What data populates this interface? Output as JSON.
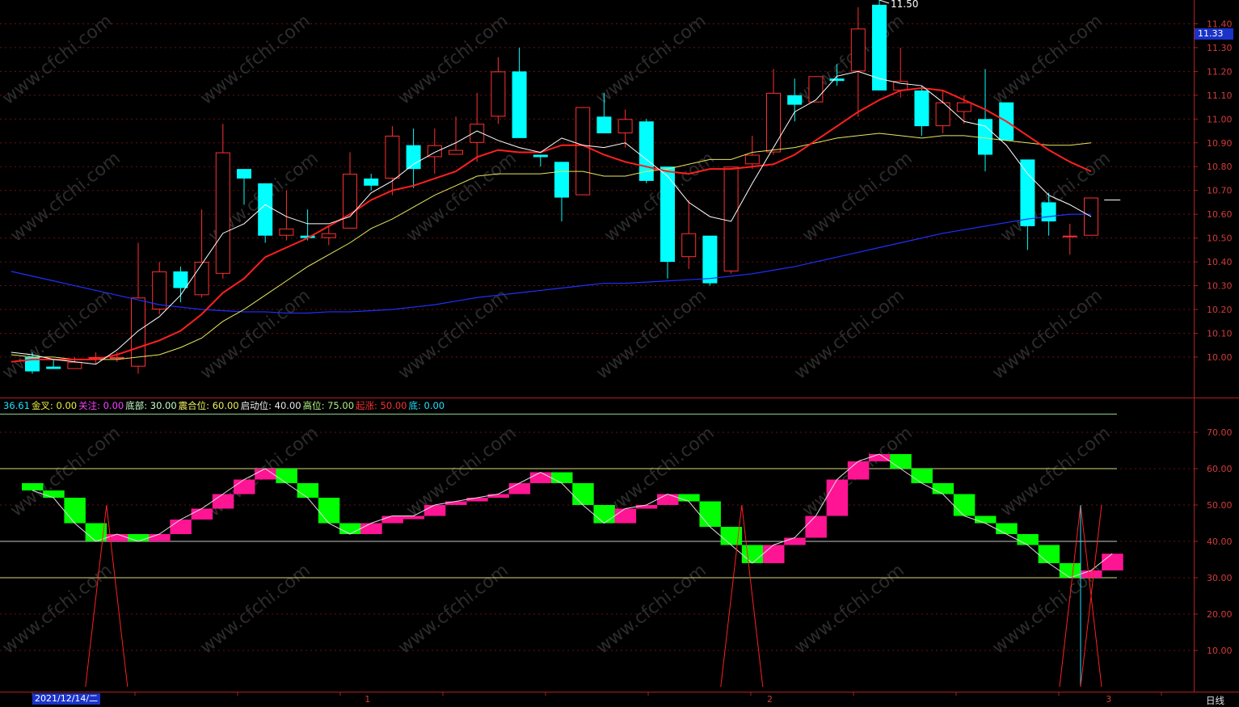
{
  "price_tag": "11.33",
  "period_label": "日线",
  "date_label": "2021/12/14/二",
  "xaxis_marks": [
    {
      "label": "1",
      "idx": 16
    },
    {
      "label": "2",
      "idx": 35
    },
    {
      "label": "3",
      "idx": 51
    }
  ],
  "indicator_header": [
    {
      "text": "36.61",
      "color": "#20e0ff"
    },
    {
      "text": "金叉: 0.00",
      "color": "#f0f040"
    },
    {
      "text": "关注: 0.00",
      "color": "#ff40ff"
    },
    {
      "text": "底部: 30.00",
      "color": "#c8ffc8"
    },
    {
      "text": "震合位: 60.00",
      "color": "#f0f060"
    },
    {
      "text": "启动位: 40.00",
      "color": "#e8e8e8"
    },
    {
      "text": "高位: 75.00",
      "color": "#b0f080"
    },
    {
      "text": "起涨: 50.00",
      "color": "#ff3030"
    },
    {
      "text": "底: 0.00",
      "color": "#20e0ff"
    }
  ],
  "watermark": "www.cfchi.com",
  "chart_data": [
    {
      "type": "candlestick",
      "title": "",
      "ylim": [
        9.83,
        11.5
      ],
      "yticks": [
        "10.00",
        "10.10",
        "10.20",
        "10.30",
        "10.40",
        "10.50",
        "10.60",
        "10.70",
        "10.80",
        "10.90",
        "11.00",
        "11.10",
        "11.20",
        "11.30",
        "11.40"
      ],
      "high_annotation": "11.50",
      "colors": {
        "up": "#ff3030",
        "down": "#00ffff",
        "ma5": "#ffffff",
        "ma10": "#ff2020",
        "ma20": "#e8e860",
        "ma60": "#2030ff"
      },
      "candles": [
        {
          "o": 10.0,
          "h": 10.02,
          "l": 9.93,
          "c": 9.94
        },
        {
          "o": 9.96,
          "h": 9.99,
          "l": 9.95,
          "c": 9.95
        },
        {
          "o": 9.95,
          "h": 10.0,
          "l": 9.95,
          "c": 9.98
        },
        {
          "o": 10.0,
          "h": 10.02,
          "l": 9.97,
          "c": 10.0
        },
        {
          "o": 10.0,
          "h": 10.02,
          "l": 9.98,
          "c": 10.0
        },
        {
          "o": 9.96,
          "h": 10.48,
          "l": 9.93,
          "c": 10.25
        },
        {
          "o": 10.2,
          "h": 10.4,
          "l": 10.18,
          "c": 10.36
        },
        {
          "o": 10.36,
          "h": 10.38,
          "l": 10.23,
          "c": 10.29
        },
        {
          "o": 10.26,
          "h": 10.62,
          "l": 10.25,
          "c": 10.4
        },
        {
          "o": 10.35,
          "h": 10.98,
          "l": 10.33,
          "c": 10.86
        },
        {
          "o": 10.79,
          "h": 10.79,
          "l": 10.64,
          "c": 10.75
        },
        {
          "o": 10.73,
          "h": 10.73,
          "l": 10.48,
          "c": 10.51
        },
        {
          "o": 10.51,
          "h": 10.7,
          "l": 10.49,
          "c": 10.54
        },
        {
          "o": 10.51,
          "h": 10.62,
          "l": 10.49,
          "c": 10.5
        },
        {
          "o": 10.5,
          "h": 10.55,
          "l": 10.47,
          "c": 10.52
        },
        {
          "o": 10.54,
          "h": 10.86,
          "l": 10.54,
          "c": 10.77
        },
        {
          "o": 10.75,
          "h": 10.77,
          "l": 10.7,
          "c": 10.72
        },
        {
          "o": 10.75,
          "h": 10.97,
          "l": 10.68,
          "c": 10.93
        },
        {
          "o": 10.89,
          "h": 10.96,
          "l": 10.71,
          "c": 10.79
        },
        {
          "o": 10.84,
          "h": 10.96,
          "l": 10.77,
          "c": 10.89
        },
        {
          "o": 10.85,
          "h": 11.01,
          "l": 10.85,
          "c": 10.87
        },
        {
          "o": 10.9,
          "h": 11.11,
          "l": 10.82,
          "c": 10.98
        },
        {
          "o": 11.01,
          "h": 11.26,
          "l": 10.98,
          "c": 11.2
        },
        {
          "o": 11.2,
          "h": 11.3,
          "l": 10.94,
          "c": 10.92
        },
        {
          "o": 10.85,
          "h": 10.85,
          "l": 10.8,
          "c": 10.84
        },
        {
          "o": 10.82,
          "h": 10.82,
          "l": 10.57,
          "c": 10.67
        },
        {
          "o": 10.68,
          "h": 11.05,
          "l": 10.68,
          "c": 11.05
        },
        {
          "o": 11.01,
          "h": 11.11,
          "l": 10.94,
          "c": 10.94
        },
        {
          "o": 10.94,
          "h": 11.04,
          "l": 10.88,
          "c": 11.0
        },
        {
          "o": 10.99,
          "h": 11.0,
          "l": 10.73,
          "c": 10.74
        },
        {
          "o": 10.8,
          "h": 10.8,
          "l": 10.33,
          "c": 10.4
        },
        {
          "o": 10.42,
          "h": 10.66,
          "l": 10.37,
          "c": 10.52
        },
        {
          "o": 10.51,
          "h": 10.51,
          "l": 10.3,
          "c": 10.31
        },
        {
          "o": 10.36,
          "h": 10.8,
          "l": 10.35,
          "c": 10.8
        },
        {
          "o": 10.81,
          "h": 10.93,
          "l": 10.79,
          "c": 10.85
        },
        {
          "o": 10.86,
          "h": 11.21,
          "l": 10.85,
          "c": 11.11
        },
        {
          "o": 11.1,
          "h": 11.17,
          "l": 10.99,
          "c": 11.06
        },
        {
          "o": 11.07,
          "h": 11.18,
          "l": 11.07,
          "c": 11.18
        },
        {
          "o": 11.17,
          "h": 11.23,
          "l": 11.14,
          "c": 11.16
        },
        {
          "o": 11.2,
          "h": 11.47,
          "l": 11.01,
          "c": 11.38
        },
        {
          "o": 11.48,
          "h": 11.5,
          "l": 11.12,
          "c": 11.12
        },
        {
          "o": 11.12,
          "h": 11.3,
          "l": 11.09,
          "c": 11.16
        },
        {
          "o": 11.12,
          "h": 11.14,
          "l": 10.93,
          "c": 10.97
        },
        {
          "o": 10.97,
          "h": 11.12,
          "l": 10.94,
          "c": 11.07
        },
        {
          "o": 11.03,
          "h": 11.1,
          "l": 10.98,
          "c": 11.07
        },
        {
          "o": 11.0,
          "h": 11.21,
          "l": 10.78,
          "c": 10.85
        },
        {
          "o": 11.07,
          "h": 11.07,
          "l": 10.91,
          "c": 10.91
        },
        {
          "o": 10.83,
          "h": 10.83,
          "l": 10.45,
          "c": 10.55
        },
        {
          "o": 10.65,
          "h": 10.69,
          "l": 10.51,
          "c": 10.57
        },
        {
          "o": 10.51,
          "h": 10.56,
          "l": 10.43,
          "c": 10.51
        },
        {
          "o": 10.51,
          "h": 10.67,
          "l": 10.51,
          "c": 10.67
        }
      ],
      "last_price": 10.66,
      "ma5": [
        10.02,
        10.01,
        9.99,
        9.98,
        9.97,
        10.03,
        10.11,
        10.17,
        10.26,
        10.39,
        10.52,
        10.56,
        10.64,
        10.59,
        10.56,
        10.56,
        10.59,
        10.69,
        10.74,
        10.81,
        10.86,
        10.9,
        10.95,
        10.91,
        10.88,
        10.86,
        10.92,
        10.89,
        10.88,
        10.9,
        10.83,
        10.76,
        10.65,
        10.59,
        10.57,
        10.73,
        10.88,
        11.03,
        11.08,
        11.18,
        11.2,
        11.17,
        11.15,
        11.14,
        11.07,
        10.99,
        10.97,
        10.89,
        10.77,
        10.68,
        10.64,
        10.59
      ],
      "ma10": [
        9.98,
        9.99,
        9.99,
        9.99,
        9.99,
        10.01,
        10.04,
        10.07,
        10.11,
        10.18,
        10.27,
        10.33,
        10.42,
        10.46,
        10.5,
        10.55,
        10.6,
        10.66,
        10.7,
        10.72,
        10.75,
        10.78,
        10.84,
        10.87,
        10.86,
        10.86,
        10.89,
        10.89,
        10.85,
        10.82,
        10.8,
        10.78,
        10.77,
        10.79,
        10.79,
        10.8,
        10.81,
        10.85,
        10.91,
        10.97,
        11.03,
        11.08,
        11.12,
        11.13,
        11.12,
        11.08,
        11.04,
        10.99,
        10.93,
        10.87,
        10.82,
        10.78
      ],
      "ma20": [
        10.01,
        10.0,
        10.0,
        9.99,
        9.99,
        9.99,
        10.0,
        10.01,
        10.04,
        10.08,
        10.15,
        10.2,
        10.26,
        10.32,
        10.38,
        10.43,
        10.48,
        10.54,
        10.58,
        10.63,
        10.68,
        10.72,
        10.76,
        10.77,
        10.77,
        10.77,
        10.78,
        10.78,
        10.76,
        10.76,
        10.78,
        10.79,
        10.81,
        10.83,
        10.83,
        10.86,
        10.87,
        10.88,
        10.9,
        10.92,
        10.93,
        10.94,
        10.93,
        10.92,
        10.93,
        10.93,
        10.92,
        10.91,
        10.9,
        10.89,
        10.89,
        10.9
      ],
      "ma60": [
        10.36,
        10.34,
        10.32,
        10.3,
        10.28,
        10.26,
        10.24,
        10.22,
        10.21,
        10.2,
        10.195,
        10.19,
        10.19,
        10.185,
        10.185,
        10.19,
        10.19,
        10.195,
        10.2,
        10.21,
        10.22,
        10.235,
        10.25,
        10.26,
        10.27,
        10.28,
        10.29,
        10.3,
        10.31,
        10.31,
        10.315,
        10.32,
        10.325,
        10.33,
        10.34,
        10.35,
        10.365,
        10.38,
        10.4,
        10.42,
        10.44,
        10.46,
        10.48,
        10.5,
        10.52,
        10.535,
        10.55,
        10.565,
        10.58,
        10.59,
        10.6,
        10.6
      ]
    },
    {
      "type": "bar",
      "title": "",
      "ylim": [
        0,
        80
      ],
      "yticks": [
        "10.00",
        "20.00",
        "30.00",
        "40.00",
        "50.00",
        "60.00",
        "70.00"
      ],
      "hlines": [
        30,
        40,
        60,
        75
      ],
      "colors": {
        "up": "#ff1493",
        "down": "#00ff00",
        "signal": "#ff2020",
        "line": "#e0e0e0",
        "vline": "#20e0ff"
      },
      "series": [
        {
          "name": "36.61",
          "values": [
            54,
            52,
            45,
            40,
            42,
            40,
            42,
            46,
            49,
            53,
            57,
            60,
            56,
            52,
            45,
            42,
            45,
            47,
            47,
            50,
            51,
            52,
            53,
            56,
            59,
            56,
            50,
            45,
            49,
            50,
            53,
            51,
            44,
            39,
            34,
            39,
            41,
            47,
            57,
            62,
            64,
            60,
            56,
            53,
            47,
            45,
            42,
            39,
            34,
            30,
            32,
            36.61
          ]
        }
      ],
      "signals": [
        4,
        34,
        50
      ],
      "vline_index": 50
    }
  ]
}
